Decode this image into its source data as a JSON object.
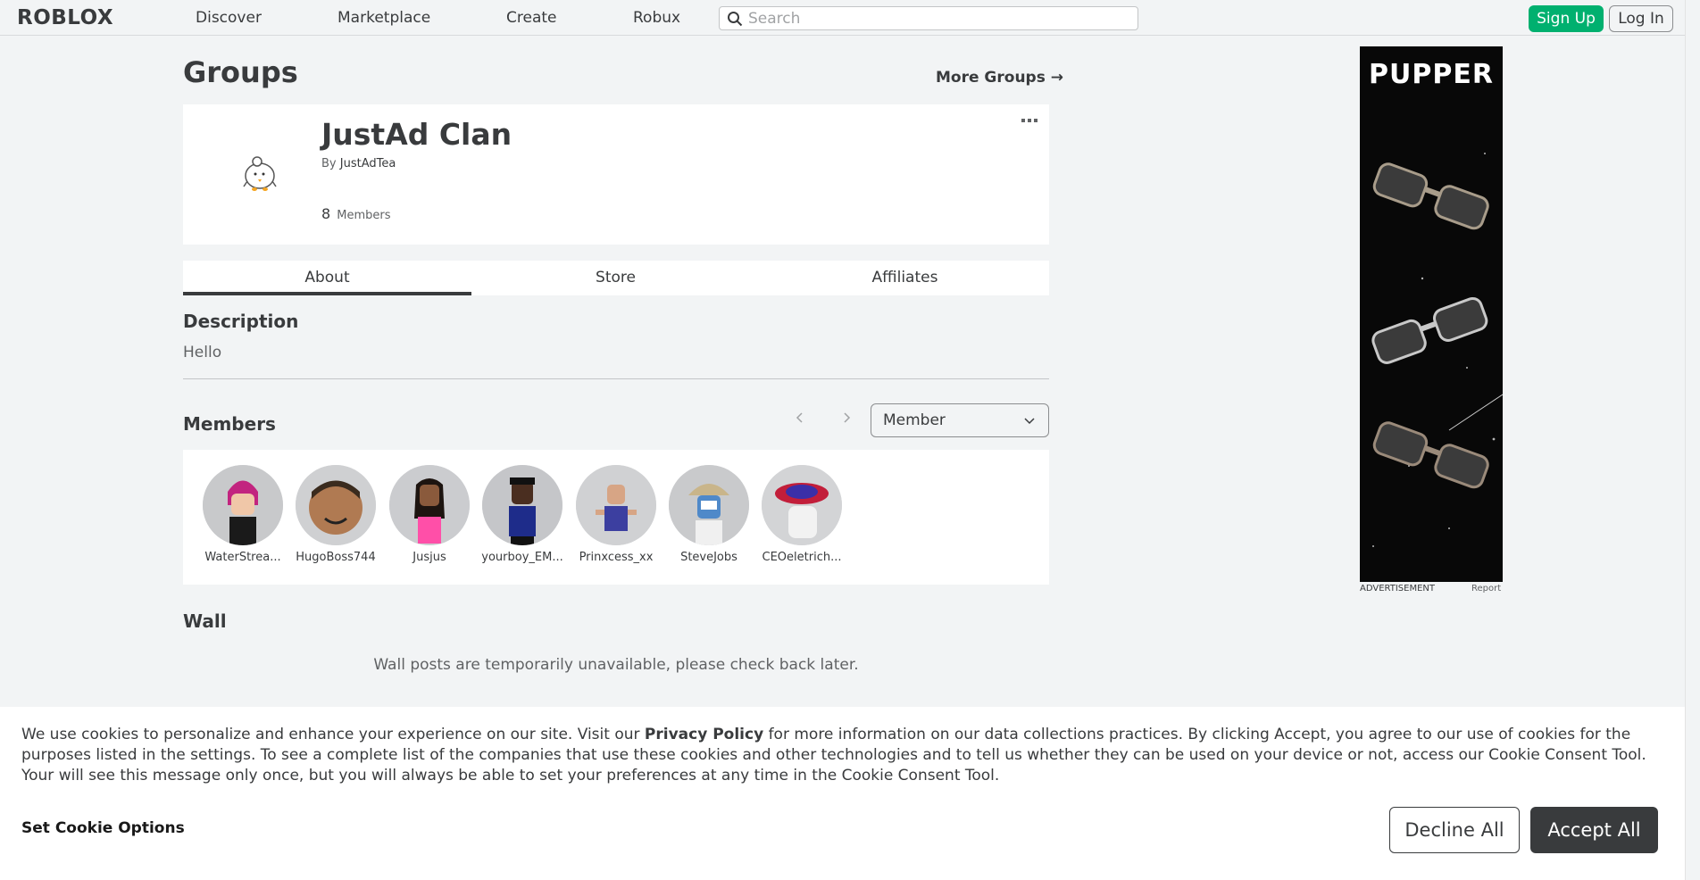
{
  "nav": {
    "logo": "ROBLOX",
    "links": [
      "Discover",
      "Marketplace",
      "Create",
      "Robux"
    ],
    "search_placeholder": "Search",
    "signup_label": "Sign Up",
    "login_label": "Log In"
  },
  "page": {
    "title": "Groups",
    "more_groups": "More Groups →"
  },
  "group": {
    "name": "JustAd Clan",
    "by_label": "By",
    "owner": "JustAdTea",
    "member_count": "8",
    "members_label": "Members"
  },
  "tabs": [
    "About",
    "Store",
    "Affiliates"
  ],
  "description": {
    "title": "Description",
    "text": "Hello"
  },
  "members": {
    "title": "Members",
    "role_selected": "Member",
    "list": [
      {
        "name": "WaterStrea...",
        "color": "#c8c9cb"
      },
      {
        "name": "HugoBoss744",
        "color": "#cfd0d2"
      },
      {
        "name": "Jusjus",
        "color": "#cbcccf"
      },
      {
        "name": "yourboy_EM...",
        "color": "#c5c6c9"
      },
      {
        "name": "Prinxcess_xx",
        "color": "#d0d1d3"
      },
      {
        "name": "SteveJobs",
        "color": "#c9cacc"
      },
      {
        "name": "CEOeletrich...",
        "color": "#d3d4d6"
      }
    ]
  },
  "wall": {
    "title": "Wall",
    "message": "Wall posts are temporarily unavailable, please check back later."
  },
  "ad": {
    "brand": "PUPPER",
    "label": "ADVERTISEMENT",
    "report": "Report"
  },
  "cookie": {
    "text_before": "We use cookies to personalize and enhance your experience on our site. Visit our ",
    "privacy_link": "Privacy Policy",
    "text_after": " for more information on our data collections practices. By clicking Accept, you agree to our use of cookies for the purposes listed in the settings. To see a complete list of the companies that use these cookies and other technologies and to tell us whether they can be used on your device or not, access our Cookie Consent Tool. Your will see this message only once, but you will always be able to set your preferences at any time in the Cookie Consent Tool.",
    "set_options": "Set Cookie Options",
    "decline": "Decline All",
    "accept": "Accept All"
  }
}
